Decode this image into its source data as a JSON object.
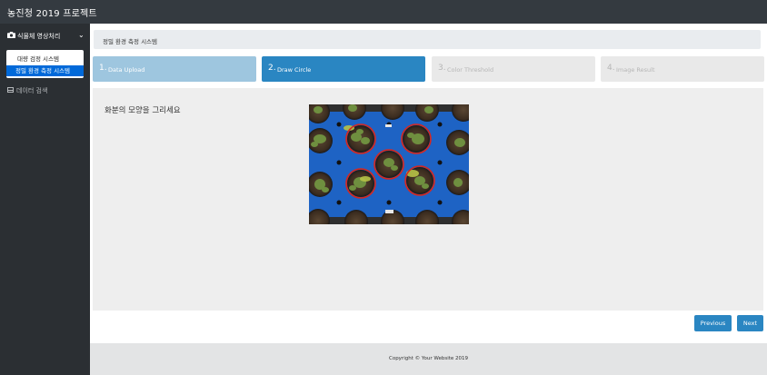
{
  "app": {
    "title": "농진청 2019 프로젝트"
  },
  "sidebar": {
    "section_label": "식물체 영상처리",
    "section_icon": "camera-icon",
    "submenu": [
      {
        "label": "대량 검정 시스템",
        "active": false
      },
      {
        "label": "정밀 환경 측정 시스템",
        "active": true
      }
    ],
    "data_search_label": "데이터 검색",
    "data_search_icon": "table-icon"
  },
  "breadcrumb": {
    "text": "정밀 환경 측정 시스템"
  },
  "steps": [
    {
      "number": "1.",
      "label": "Data Upload",
      "state": "done"
    },
    {
      "number": "2.",
      "label": "Draw Circle",
      "state": "active"
    },
    {
      "number": "3.",
      "label": "Color Threshold",
      "state": "disabled"
    },
    {
      "number": "4.",
      "label": "Image Result",
      "state": "disabled"
    }
  ],
  "main": {
    "instruction": "화분의 모양을 그리세요"
  },
  "buttons": {
    "previous": "Previous",
    "next": "Next"
  },
  "footer": {
    "text": "Copyright © Your Website 2019"
  },
  "colors": {
    "accent": "#2a86c2",
    "active_menu": "#0069d9",
    "topbar": "#343a40",
    "circle": "#d9261c"
  }
}
